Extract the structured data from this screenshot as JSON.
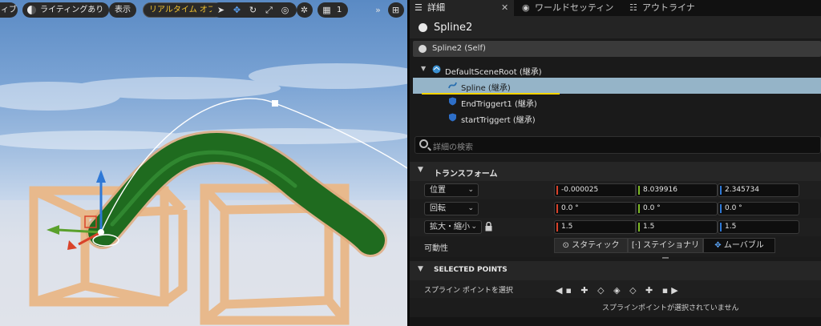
{
  "viewport": {
    "toolbar": {
      "mode_partial": "ィブ",
      "lighting": "ライティングあり",
      "show": "表示",
      "realtime": "リアルタイム オフ",
      "grid_value": "1"
    }
  },
  "tabs": [
    {
      "label": "詳細",
      "icon": "details-icon"
    },
    {
      "label": "ワールドセッティン",
      "icon": "globe-icon"
    },
    {
      "label": "アウトライナ",
      "icon": "outliner-icon"
    }
  ],
  "details": {
    "object_name": "Spline2",
    "self_label": "Spline2 (Self)",
    "components": [
      {
        "label": "DefaultSceneRoot (継承)",
        "icon": "scene-root-icon",
        "selected": false,
        "expanded": true
      },
      {
        "label": "Spline (継承)",
        "icon": "spline-icon",
        "selected": true
      },
      {
        "label": "EndTriggert1 (継承)",
        "icon": "box-shield-icon",
        "selected": false
      },
      {
        "label": "startTriggert (継承)",
        "icon": "box-shield-icon",
        "selected": false
      }
    ],
    "search_placeholder": "詳細の検索",
    "transform": {
      "header": "トランスフォーム",
      "location": {
        "label": "位置",
        "x": "-0.000025",
        "y": "8.039916",
        "z": "2.345734"
      },
      "rotation": {
        "label": "回転",
        "x": "0.0 °",
        "y": "0.0 °",
        "z": "0.0 °"
      },
      "scale": {
        "label": "拡大・縮小",
        "x": "1.5",
        "y": "1.5",
        "z": "1.5"
      },
      "mobility": {
        "label": "可動性",
        "options": [
          "スタティック",
          "ステイショナリー",
          "ムーバブル"
        ],
        "selected": "ムーバブル"
      }
    },
    "selected_points": {
      "header": "SELECTED POINTS",
      "select_label": "スプライン ポイントを選択",
      "status": "スプラインポイントが選択されていません"
    }
  },
  "colors": {
    "selection": "#95b4c8",
    "highlight_underline": "#ffd400",
    "axis_x": "#d9422a",
    "axis_y": "#7cb824",
    "axis_z": "#2e78d6",
    "spline_mesh": "#1f6b1f"
  }
}
